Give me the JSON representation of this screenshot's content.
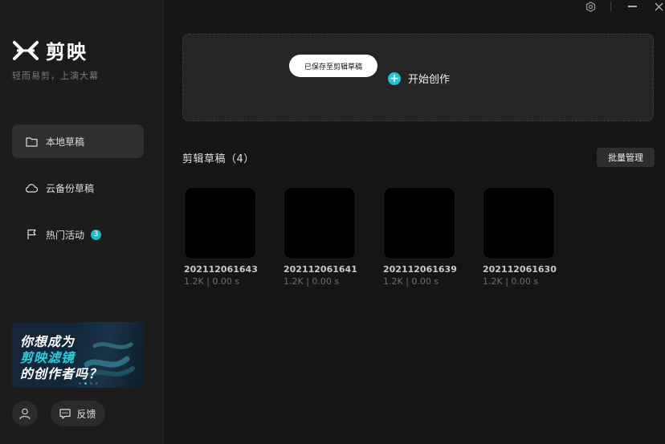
{
  "app": {
    "name": "剪映",
    "slogan": "轻而易剪，上演大幕"
  },
  "sidebar": {
    "items": [
      {
        "label": "本地草稿",
        "icon": "folder-icon",
        "active": true
      },
      {
        "label": "云备份草稿",
        "icon": "cloud-icon",
        "active": false
      },
      {
        "label": "热门活动",
        "icon": "flag-icon",
        "badge": "3",
        "active": false
      }
    ],
    "banner": {
      "line1": "你想成为",
      "line2": "剪映滤镜",
      "line3": "的创作者吗？"
    },
    "feedback_label": "反馈"
  },
  "create": {
    "toast": "已保存至剪辑草稿",
    "start_label": "开始创作"
  },
  "drafts": {
    "title": "剪辑草稿（4）",
    "batch_label": "批量管理",
    "items": [
      {
        "name": "202112061643",
        "meta": "1.2K | 0.00 s"
      },
      {
        "name": "202112061641",
        "meta": "1.2K | 0.00 s"
      },
      {
        "name": "202112061639",
        "meta": "1.2K | 0.00 s"
      },
      {
        "name": "202112061630",
        "meta": "1.2K | 0.00 s"
      }
    ]
  },
  "colors": {
    "accent": "#1fc3d1",
    "background": "#151515",
    "sidebar": "#1c1c1c"
  }
}
